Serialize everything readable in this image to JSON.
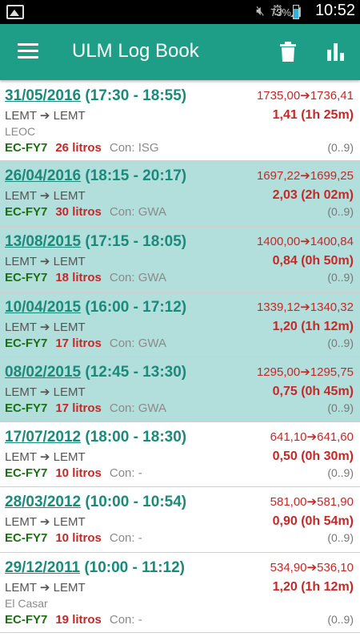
{
  "status_bar": {
    "battery": "73%",
    "time": "10:52",
    "network": "4G"
  },
  "app_bar": {
    "title": "ULM Log Book",
    "menu_icon": "menu-icon",
    "delete_icon": "trash-icon",
    "stats_icon": "bar-chart-icon"
  },
  "colors": {
    "primary": "#1e9e86",
    "selected_row": "#b2dfdb",
    "date_text": "#1a8a7a",
    "red": "#c62828",
    "registration": "#1b6e12"
  },
  "entries": [
    {
      "date": "31/05/2016",
      "time_range": "(17:30 - 18:55)",
      "counter_start": "1735,00",
      "counter_end": "1736,41",
      "from": "LEMT",
      "to": "LEMT",
      "duration": "1,41 (1h 25m)",
      "note": "LEOC",
      "registration": "EC-FY7",
      "fuel": "26 litros",
      "pilot": "Con: ISG",
      "range": "(0..9)",
      "selected": false
    },
    {
      "date": "26/04/2016",
      "time_range": "(18:15 - 20:17)",
      "counter_start": "1697,22",
      "counter_end": "1699,25",
      "from": "LEMT",
      "to": "LEMT",
      "duration": "2,03 (2h 02m)",
      "note": "",
      "registration": "EC-FY7",
      "fuel": "30 litros",
      "pilot": "Con: GWA",
      "range": "(0..9)",
      "selected": true
    },
    {
      "date": "13/08/2015",
      "time_range": "(17:15 - 18:05)",
      "counter_start": "1400,00",
      "counter_end": "1400,84",
      "from": "LEMT",
      "to": "LEMT",
      "duration": "0,84 (0h 50m)",
      "note": "",
      "registration": "EC-FY7",
      "fuel": "18 litros",
      "pilot": "Con: GWA",
      "range": "(0..9)",
      "selected": true
    },
    {
      "date": "10/04/2015",
      "time_range": "(16:00 - 17:12)",
      "counter_start": "1339,12",
      "counter_end": "1340,32",
      "from": "LEMT",
      "to": "LEMT",
      "duration": "1,20 (1h 12m)",
      "note": "",
      "registration": "EC-FY7",
      "fuel": "17 litros",
      "pilot": "Con: GWA",
      "range": "(0..9)",
      "selected": true
    },
    {
      "date": "08/02/2015",
      "time_range": "(12:45 - 13:30)",
      "counter_start": "1295,00",
      "counter_end": "1295,75",
      "from": "LEMT",
      "to": "LEMT",
      "duration": "0,75 (0h 45m)",
      "note": "",
      "registration": "EC-FY7",
      "fuel": "17 litros",
      "pilot": "Con: GWA",
      "range": "(0..9)",
      "selected": true
    },
    {
      "date": "17/07/2012",
      "time_range": "(18:00 - 18:30)",
      "counter_start": "641,10",
      "counter_end": "641,60",
      "from": "LEMT",
      "to": "LEMT",
      "duration": "0,50 (0h 30m)",
      "note": "",
      "registration": "EC-FY7",
      "fuel": "10 litros",
      "pilot": "Con: -",
      "range": "(0..9)",
      "selected": false
    },
    {
      "date": "28/03/2012",
      "time_range": "(10:00 - 10:54)",
      "counter_start": "581,00",
      "counter_end": "581,90",
      "from": "LEMT",
      "to": "LEMT",
      "duration": "0,90 (0h 54m)",
      "note": "",
      "registration": "EC-FY7",
      "fuel": "10 litros",
      "pilot": "Con: -",
      "range": "(0..9)",
      "selected": false
    },
    {
      "date": "29/12/2011",
      "time_range": "(10:00 - 11:12)",
      "counter_start": "534,90",
      "counter_end": "536,10",
      "from": "LEMT",
      "to": "LEMT",
      "duration": "1,20 (1h 12m)",
      "note": "El Casar",
      "registration": "EC-FY7",
      "fuel": "19 litros",
      "pilot": "Con: -",
      "range": "(0..9)",
      "selected": false
    }
  ]
}
